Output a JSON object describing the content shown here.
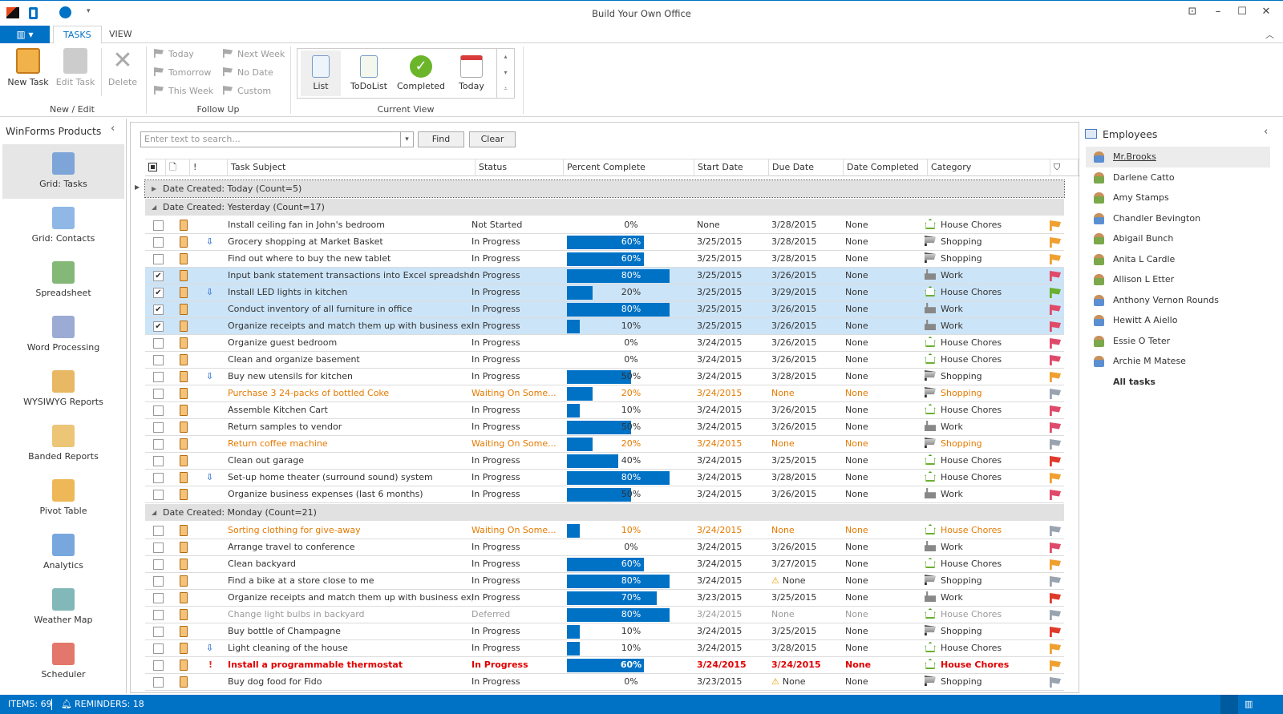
{
  "window": {
    "title": "Build Your Own Office"
  },
  "ribbon": {
    "tabs": [
      {
        "label": "TASKS",
        "active": true
      },
      {
        "label": "VIEW",
        "active": false
      }
    ],
    "new_edit": {
      "label": "New / Edit",
      "new_task": "New Task",
      "edit_task": "Edit Task",
      "delete": "Delete"
    },
    "follow_up": {
      "label": "Follow Up",
      "items": [
        "Today",
        "Tomorrow",
        "This Week",
        "Next Week",
        "No Date",
        "Custom"
      ]
    },
    "current_view": {
      "label": "Current View",
      "items": [
        "List",
        "ToDoList",
        "Completed",
        "Today"
      ],
      "selected": "List"
    }
  },
  "left_panel": {
    "title": "WinForms Products",
    "items": [
      "Grid: Tasks",
      "Grid: Contacts",
      "Spreadsheet",
      "Word Processing",
      "WYSIWYG Reports",
      "Banded Reports",
      "Pivot Table",
      "Analytics",
      "Weather Map",
      "Scheduler"
    ],
    "selected": "Grid: Tasks"
  },
  "search": {
    "placeholder": "Enter text to search...",
    "find": "Find",
    "clear": "Clear"
  },
  "columns": [
    "Task Subject",
    "Status",
    "Percent Complete",
    "Start Date",
    "Due Date",
    "Date Completed",
    "Category"
  ],
  "colors": {
    "accent": "#0072c6",
    "waiting": "#e57a00",
    "overdue": "#e00000",
    "deferred": "#999999",
    "selected_row": "#cce4f7"
  },
  "groups": [
    {
      "label": "Date Created: Today (Count=5)",
      "expanded": false,
      "rows": []
    },
    {
      "label": "Date Created: Yesterday (Count=17)",
      "expanded": true,
      "rows": [
        {
          "checked": false,
          "priority": "",
          "subject": "Install ceiling fan in John's bedroom",
          "status": "Not Started",
          "percent": 0,
          "start": "None",
          "due": "3/28/2015",
          "completed": "None",
          "category": "House Chores",
          "flag": "orange",
          "style": ""
        },
        {
          "checked": false,
          "priority": "low",
          "subject": "Grocery shopping at Market Basket",
          "status": "In Progress",
          "percent": 60,
          "start": "3/25/2015",
          "due": "3/28/2015",
          "completed": "None",
          "category": "Shopping",
          "flag": "orange",
          "style": ""
        },
        {
          "checked": false,
          "priority": "",
          "subject": "Find out where to buy the new tablet",
          "status": "In Progress",
          "percent": 60,
          "start": "3/25/2015",
          "due": "3/28/2015",
          "completed": "None",
          "category": "Shopping",
          "flag": "orange",
          "style": ""
        },
        {
          "checked": true,
          "priority": "",
          "subject": "Input bank statement transactions into Excel spreadsheet",
          "status": "In Progress",
          "percent": 80,
          "start": "3/25/2015",
          "due": "3/26/2015",
          "completed": "None",
          "category": "Work",
          "flag": "pink",
          "style": "sel"
        },
        {
          "checked": true,
          "priority": "low",
          "subject": "Install LED lights in kitchen",
          "status": "In Progress",
          "percent": 20,
          "start": "3/25/2015",
          "due": "3/29/2015",
          "completed": "None",
          "category": "House Chores",
          "flag": "green",
          "style": "sel"
        },
        {
          "checked": true,
          "priority": "",
          "subject": "Conduct inventory of all furniture in office",
          "status": "In Progress",
          "percent": 80,
          "start": "3/25/2015",
          "due": "3/26/2015",
          "completed": "None",
          "category": "Work",
          "flag": "pink",
          "style": "sel"
        },
        {
          "checked": true,
          "priority": "",
          "subject": "Organize receipts and match them up with business expe...",
          "status": "In Progress",
          "percent": 10,
          "start": "3/25/2015",
          "due": "3/26/2015",
          "completed": "None",
          "category": "Work",
          "flag": "pink",
          "style": "sel"
        },
        {
          "checked": false,
          "priority": "",
          "subject": "Organize guest bedroom",
          "status": "In Progress",
          "percent": 0,
          "start": "3/24/2015",
          "due": "3/26/2015",
          "completed": "None",
          "category": "House Chores",
          "flag": "pink",
          "style": ""
        },
        {
          "checked": false,
          "priority": "",
          "subject": "Clean and organize basement",
          "status": "In Progress",
          "percent": 0,
          "start": "3/24/2015",
          "due": "3/26/2015",
          "completed": "None",
          "category": "House Chores",
          "flag": "pink",
          "style": ""
        },
        {
          "checked": false,
          "priority": "low",
          "subject": "Buy new utensils for kitchen",
          "status": "In Progress",
          "percent": 50,
          "start": "3/24/2015",
          "due": "3/28/2015",
          "completed": "None",
          "category": "Shopping",
          "flag": "orange",
          "style": ""
        },
        {
          "checked": false,
          "priority": "",
          "subject": "Purchase 3 24-packs of bottled Coke",
          "status": "Waiting On Some...",
          "percent": 20,
          "start": "3/24/2015",
          "due": "None",
          "completed": "None",
          "category": "Shopping",
          "flag": "gray",
          "style": "orange"
        },
        {
          "checked": false,
          "priority": "",
          "subject": "Assemble Kitchen Cart",
          "status": "In Progress",
          "percent": 10,
          "start": "3/24/2015",
          "due": "3/26/2015",
          "completed": "None",
          "category": "House Chores",
          "flag": "pink",
          "style": ""
        },
        {
          "checked": false,
          "priority": "",
          "subject": "Return samples to vendor",
          "status": "In Progress",
          "percent": 50,
          "start": "3/24/2015",
          "due": "3/26/2015",
          "completed": "None",
          "category": "Work",
          "flag": "pink",
          "style": ""
        },
        {
          "checked": false,
          "priority": "",
          "subject": "Return coffee machine",
          "status": "Waiting On Some...",
          "percent": 20,
          "start": "3/24/2015",
          "due": "None",
          "completed": "None",
          "category": "Shopping",
          "flag": "gray",
          "style": "orange"
        },
        {
          "checked": false,
          "priority": "",
          "subject": "Clean out garage",
          "status": "In Progress",
          "percent": 40,
          "start": "3/24/2015",
          "due": "3/25/2015",
          "completed": "None",
          "category": "House Chores",
          "flag": "red",
          "style": ""
        },
        {
          "checked": false,
          "priority": "low",
          "subject": "Set-up home theater (surround sound) system",
          "status": "In Progress",
          "percent": 80,
          "start": "3/24/2015",
          "due": "3/28/2015",
          "completed": "None",
          "category": "House Chores",
          "flag": "orange",
          "style": ""
        },
        {
          "checked": false,
          "priority": "",
          "subject": "Organize business expenses (last 6 months)",
          "status": "In Progress",
          "percent": 50,
          "start": "3/24/2015",
          "due": "3/26/2015",
          "completed": "None",
          "category": "Work",
          "flag": "pink",
          "style": ""
        }
      ]
    },
    {
      "label": "Date Created: Monday (Count=21)",
      "expanded": true,
      "rows": [
        {
          "checked": false,
          "priority": "",
          "subject": "Sorting clothing for give-away",
          "status": "Waiting On Some...",
          "percent": 10,
          "start": "3/24/2015",
          "due": "None",
          "completed": "None",
          "category": "House Chores",
          "flag": "gray",
          "style": "orange"
        },
        {
          "checked": false,
          "priority": "",
          "subject": "Arrange travel to conference",
          "status": "In Progress",
          "percent": 0,
          "start": "3/24/2015",
          "due": "3/26/2015",
          "completed": "None",
          "category": "Work",
          "flag": "pink",
          "style": ""
        },
        {
          "checked": false,
          "priority": "",
          "subject": "Clean backyard",
          "status": "In Progress",
          "percent": 60,
          "start": "3/24/2015",
          "due": "3/27/2015",
          "completed": "None",
          "category": "House Chores",
          "flag": "orange",
          "style": ""
        },
        {
          "checked": false,
          "priority": "",
          "subject": "Find a bike at a store close to me",
          "status": "In Progress",
          "percent": 80,
          "start": "3/24/2015",
          "due": "None",
          "due_warning": true,
          "completed": "None",
          "category": "Shopping",
          "flag": "gray",
          "style": ""
        },
        {
          "checked": false,
          "priority": "",
          "subject": "Organize receipts and match them up with business expe...",
          "status": "In Progress",
          "percent": 70,
          "start": "3/23/2015",
          "due": "3/25/2015",
          "completed": "None",
          "category": "Work",
          "flag": "red",
          "style": ""
        },
        {
          "checked": false,
          "priority": "",
          "subject": "Change light bulbs in backyard",
          "status": "Deferred",
          "percent": 80,
          "start": "3/24/2015",
          "due": "None",
          "completed": "None",
          "category": "House Chores",
          "flag": "gray",
          "style": "gray"
        },
        {
          "checked": false,
          "priority": "",
          "subject": "Buy bottle of Champagne",
          "status": "In Progress",
          "percent": 10,
          "start": "3/24/2015",
          "due": "3/25/2015",
          "completed": "None",
          "category": "Shopping",
          "flag": "red",
          "style": ""
        },
        {
          "checked": false,
          "priority": "low",
          "subject": "Light cleaning of the house",
          "status": "In Progress",
          "percent": 10,
          "start": "3/24/2015",
          "due": "3/28/2015",
          "completed": "None",
          "category": "House Chores",
          "flag": "orange",
          "style": ""
        },
        {
          "checked": false,
          "priority": "high",
          "subject": "Install a programmable thermostat",
          "status": "In Progress",
          "percent": 60,
          "start": "3/24/2015",
          "due": "3/24/2015",
          "completed": "None",
          "category": "House Chores",
          "flag": "orange",
          "style": "red"
        },
        {
          "checked": false,
          "priority": "",
          "subject": "Buy dog food for Fido",
          "status": "In Progress",
          "percent": 0,
          "start": "3/23/2015",
          "due": "None",
          "due_warning": true,
          "completed": "None",
          "category": "Shopping",
          "flag": "gray",
          "style": ""
        }
      ]
    }
  ],
  "right_panel": {
    "title": "Employees",
    "employees": [
      "Mr.Brooks",
      "Darlene Catto",
      "Amy Stamps",
      "Chandler Bevington",
      "Abigail Bunch",
      "Anita L Cardle",
      "Allison L Etter",
      "Anthony Vernon Rounds",
      "Hewitt A Aiello",
      "Essie O Teter",
      "Archie M Matese"
    ],
    "selected": "Mr.Brooks",
    "all_tasks": "All tasks"
  },
  "status_bar": {
    "items": "ITEMS: 69",
    "reminders": "REMINDERS: 18"
  }
}
